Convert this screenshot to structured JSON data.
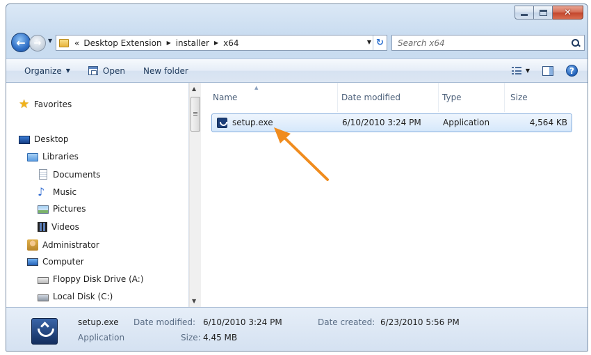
{
  "window": {
    "caption_buttons": [
      "minimize",
      "maximize",
      "close"
    ]
  },
  "address": {
    "overflow": "«",
    "crumbs": [
      "Desktop Extension",
      "installer",
      "x64"
    ],
    "search_placeholder": "Search x64"
  },
  "toolbar": {
    "organize": "Organize",
    "open": "Open",
    "new_folder": "New folder"
  },
  "nav": {
    "favorites": "Favorites",
    "desktop": "Desktop",
    "libraries": "Libraries",
    "documents": "Documents",
    "music": "Music",
    "pictures": "Pictures",
    "videos": "Videos",
    "administrator": "Administrator",
    "computer": "Computer",
    "floppy": "Floppy Disk Drive (A:)",
    "local_disk": "Local Disk (C:)"
  },
  "columns": {
    "name": "Name",
    "date_modified": "Date modified",
    "type": "Type",
    "size": "Size"
  },
  "files": [
    {
      "name": "setup.exe",
      "date_modified": "6/10/2010 3:24 PM",
      "type": "Application",
      "size": "4,564 KB"
    }
  ],
  "details": {
    "name": "setup.exe",
    "type": "Application",
    "date_modified_label": "Date modified:",
    "date_modified": "6/10/2010 3:24 PM",
    "size_label": "Size:",
    "size": "4.45 MB",
    "date_created_label": "Date created:",
    "date_created": "6/23/2010 5:56 PM"
  },
  "colors": {
    "annotation_arrow": "#f08c1e",
    "selection": "#d6e8fb"
  }
}
